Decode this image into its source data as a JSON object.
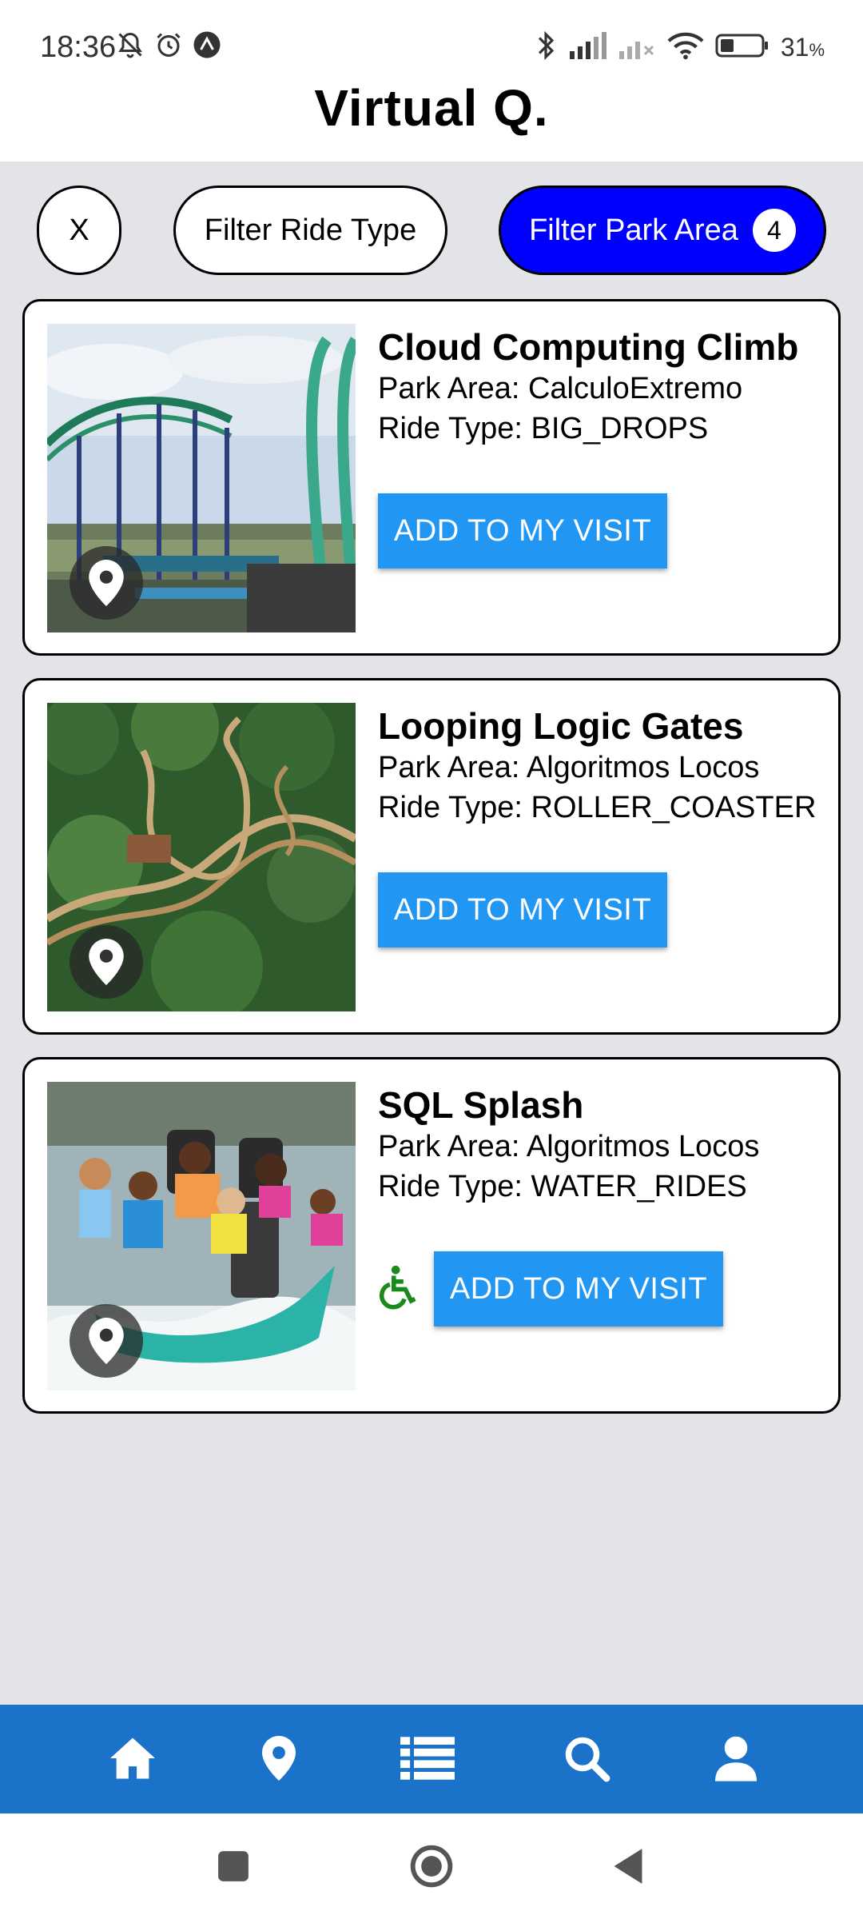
{
  "status_bar": {
    "time": "18:36",
    "battery_percent": "31",
    "battery_unit": "%",
    "left_icons": [
      "bell-off-icon",
      "alarm-icon",
      "app-notification-icon"
    ],
    "right_icons": [
      "bluetooth-icon",
      "signal-icon",
      "signal-off-icon",
      "wifi-icon",
      "battery-icon"
    ]
  },
  "header": {
    "title": "Virtual Q."
  },
  "filters": {
    "clear_label": "X",
    "ride_type_label": "Filter Ride Type",
    "park_area_label": "Filter Park Area",
    "park_area_count": "4",
    "active_color": "#0000ff"
  },
  "rides": [
    {
      "name": "Cloud Computing Climb",
      "park_area": "Park Area: CalculoExtremo",
      "ride_type": "Ride Type: BIG_DROPS",
      "button_label": "ADD TO MY VISIT",
      "accessible": false,
      "image_icon": "map-pin-icon"
    },
    {
      "name": "Looping Logic Gates",
      "park_area": "Park Area: Algoritmos Locos",
      "ride_type": "Ride Type: ROLLER_COASTER",
      "button_label": "ADD TO MY VISIT",
      "accessible": false,
      "image_icon": "map-pin-icon"
    },
    {
      "name": "SQL Splash",
      "park_area": "Park Area: Algoritmos Locos",
      "ride_type": "Ride Type: WATER_RIDES",
      "button_label": "ADD TO MY VISIT",
      "accessible": true,
      "image_icon": "map-pin-icon"
    }
  ],
  "bottom_nav": {
    "items": [
      "home-icon",
      "map-pin-icon",
      "list-icon",
      "search-icon",
      "user-icon"
    ],
    "background": "#1a73c8"
  },
  "colors": {
    "button_blue": "#2196f3",
    "accessible_green": "#1a8a1a"
  }
}
